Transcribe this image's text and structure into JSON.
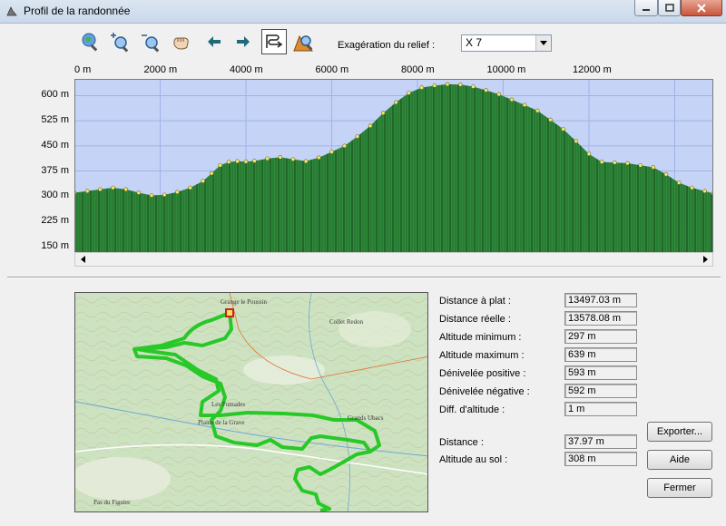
{
  "window": {
    "title": "Profil de la randonnée"
  },
  "toolbar": {
    "tools": [
      {
        "name": "globe-search-icon"
      },
      {
        "name": "zoom-in-icon"
      },
      {
        "name": "zoom-out-icon"
      },
      {
        "name": "pan-hand-icon"
      },
      {
        "name": "arrow-left-icon"
      },
      {
        "name": "arrow-right-icon"
      },
      {
        "name": "route-profile-icon",
        "active": true
      },
      {
        "name": "hiker-search-icon"
      }
    ],
    "relief_label": "Exagération du relief :",
    "relief_value": "X 7"
  },
  "chart_data": {
    "type": "area",
    "x_ticks": [
      "0 m",
      "2000 m",
      "4000 m",
      "6000 m",
      "8000 m",
      "10000 m",
      "12000 m"
    ],
    "y_ticks": [
      "600 m",
      "525 m",
      "450 m",
      "375 m",
      "300 m",
      "225 m",
      "150 m"
    ],
    "xlim": [
      0,
      14900
    ],
    "ylim": [
      130,
      650
    ],
    "grid": true,
    "x": [
      0,
      300,
      600,
      900,
      1200,
      1500,
      1800,
      2100,
      2400,
      2700,
      3000,
      3200,
      3400,
      3600,
      3800,
      4000,
      4200,
      4500,
      4800,
      5100,
      5400,
      5700,
      6000,
      6300,
      6600,
      6900,
      7200,
      7500,
      7800,
      8100,
      8400,
      8700,
      9000,
      9300,
      9600,
      9900,
      10200,
      10500,
      10800,
      11100,
      11400,
      11700,
      12000,
      12300,
      12600,
      12900,
      13200,
      13500,
      13800,
      14100,
      14400,
      14700,
      14900
    ],
    "y": [
      310,
      315,
      320,
      325,
      320,
      310,
      302,
      304,
      312,
      325,
      345,
      368,
      392,
      402,
      404,
      403,
      405,
      412,
      416,
      410,
      404,
      415,
      432,
      450,
      478,
      510,
      548,
      580,
      608,
      624,
      630,
      634,
      633,
      627,
      616,
      604,
      588,
      572,
      555,
      528,
      500,
      464,
      426,
      402,
      400,
      398,
      392,
      386,
      365,
      340,
      325,
      315,
      308
    ]
  },
  "stats": [
    {
      "label": "Distance à plat :",
      "value": "13497.03 m"
    },
    {
      "label": "Distance réelle :",
      "value": "13578.08 m"
    },
    {
      "label": "Altitude minimum :",
      "value": "297 m"
    },
    {
      "label": "Altitude maximum :",
      "value": "639 m"
    },
    {
      "label": "Dénivelée positive :",
      "value": "593 m"
    },
    {
      "label": "Dénivelée négative :",
      "value": "592 m"
    },
    {
      "label": "Diff. d'altitude :",
      "value": "1 m"
    }
  ],
  "cursor": {
    "distance_label": "Distance :",
    "distance_value": "37.97 m",
    "altitude_label": "Altitude au sol :",
    "altitude_value": "308 m"
  },
  "buttons": {
    "export": "Exporter...",
    "help": "Aide",
    "close": "Fermer"
  },
  "map": {
    "labels": [
      "Grange le Poussin",
      "Collet Redon",
      "Les Fumades",
      "Plaine de la Grave",
      "Grands Ubacs",
      "Pas du Figuier"
    ]
  },
  "colors": {
    "sky": "#c5d3f7",
    "ground": "#2e8a3a",
    "ridge_marker": "#f3e86a",
    "track": "#22cc22"
  }
}
